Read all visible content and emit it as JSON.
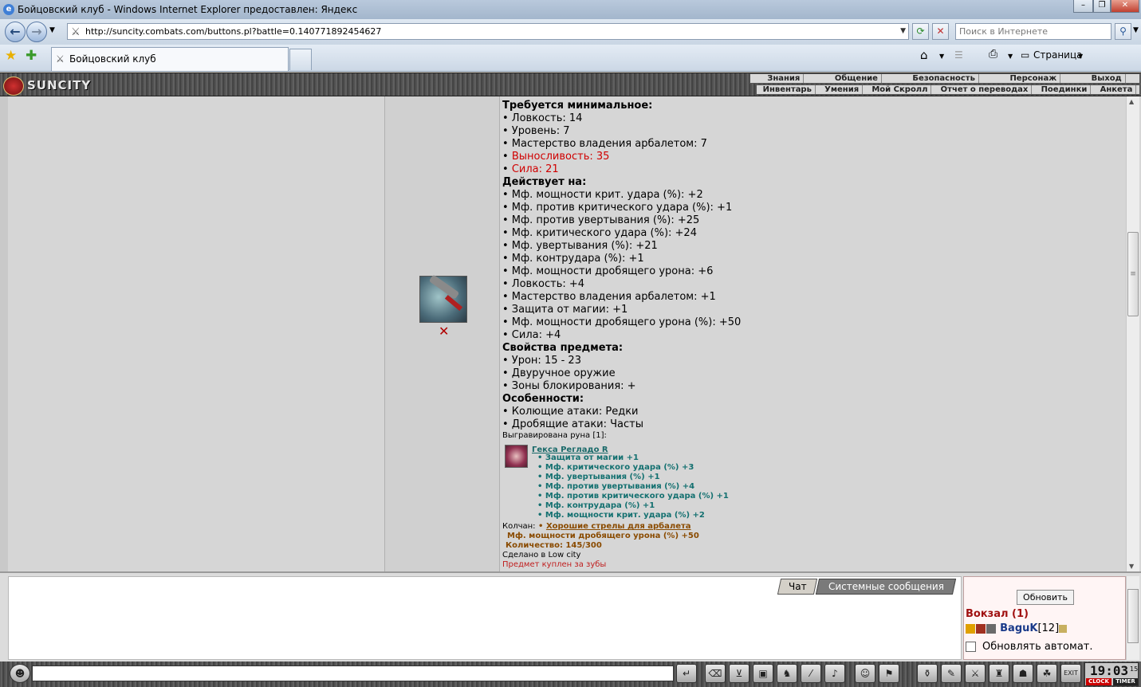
{
  "window": {
    "title": "Бойцовский клуб - Windows Internet Explorer предоставлен: Яндекс"
  },
  "nav": {
    "url": "http://suncity.combats.com/buttons.pl?battle=0.140771892454627",
    "search_placeholder": "Поиск в Интернете",
    "page_menu": "Страница"
  },
  "tab": {
    "label": "Бойцовский клуб"
  },
  "game": {
    "logo": "SUNCITY",
    "menu_top": [
      "Знания",
      "Общение",
      "Безопасность",
      "Персонаж",
      "Выход"
    ],
    "menu_bottom": [
      "Инвентарь",
      "Умения",
      "Мой Скролл",
      "Отчет о переводах",
      "Поединки",
      "Анкета"
    ]
  },
  "item": {
    "requires_header": "Требуется минимальное:",
    "requires": [
      {
        "text": "• Ловкость: 14",
        "red": false
      },
      {
        "text": "• Уровень: 7",
        "red": false
      },
      {
        "text": "• Мастерство владения арбалетом: 7",
        "red": false
      },
      {
        "text": "Выносливость: 35",
        "red": true
      },
      {
        "text": "Сила: 21",
        "red": true
      }
    ],
    "effects_header": "Действует на:",
    "effects": [
      "• Мф. мощности крит. удара (%): +2",
      "• Мф. против критического удара (%): +1",
      "• Мф. против увертывания (%): +25",
      "• Мф. критического удара (%): +24",
      "• Мф. увертывания (%): +21",
      "• Мф. контрудара (%): +1",
      "• Мф. мощности дробящего урона: +6",
      "• Ловкость: +4",
      "• Мастерство владения арбалетом: +1",
      "• Защита от магии: +1",
      "• Мф. мощности дробящего урона (%): +50",
      "• Сила: +4"
    ],
    "props_header": "Свойства предмета:",
    "props": [
      "• Урон: 15 - 23",
      "• Двуручное оружие",
      "• Зоны блокирования: +"
    ],
    "features_header": "Особенности:",
    "features": [
      "• Колющие атаки: Редки",
      "• Дробящие атаки: Часты"
    ],
    "rune_label": "Выгравирована руна [1]:",
    "rune_name": "Гекса Регладо R",
    "rune_effects": [
      "• Защита от магии +1",
      "• Мф. критического удара (%) +3",
      "• Мф. увертывания (%) +1",
      "• Мф. против увертывания (%) +4",
      "• Мф. против критического удара (%) +1",
      "• Мф. контрудара (%) +1",
      "• Мф. мощности крит. удара (%) +2"
    ],
    "quiver_label": "Колчан:",
    "quiver_name": "Хорошие стрелы для арбалета",
    "quiver_effect": "Мф. мощности дробящего урона (%) +50",
    "quiver_count": "Количество: 145/300",
    "made_in": "Сделано в Low city",
    "bought": "Предмет куплен за зубы"
  },
  "chat": {
    "tab_chat": "Чат",
    "tab_system": "Системные сообщения",
    "refresh_button": "Обновить",
    "location": "Вокзал (1)",
    "user_name": "BaguK",
    "user_level": "[12]",
    "auto_refresh": "Обновлять автомат."
  },
  "clock": {
    "time": "19:03",
    "sec": "15",
    "label1": "CLOCK",
    "label2": "TIMER"
  }
}
